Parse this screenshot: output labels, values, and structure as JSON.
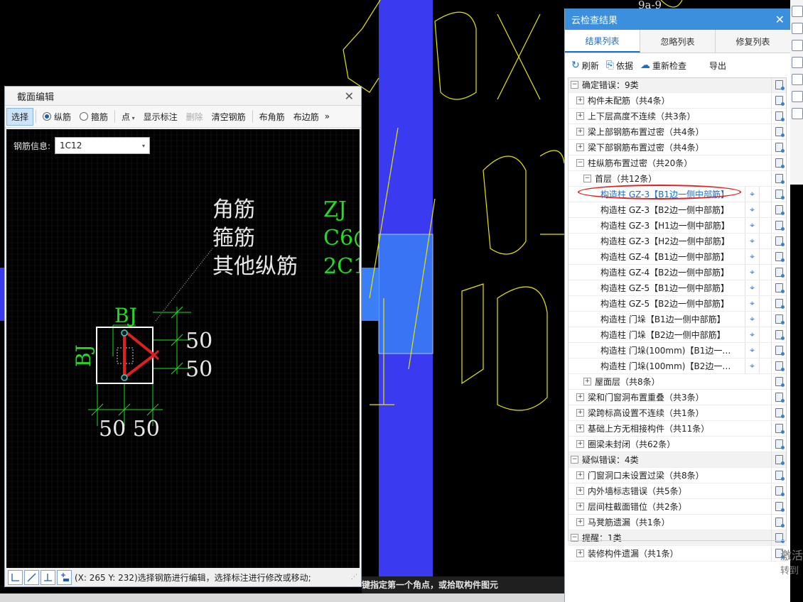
{
  "cad": {
    "label_9a9": "9a-9",
    "section": {
      "legend_labels": [
        "角筋",
        "箍筋",
        "其他纵筋"
      ],
      "legend_values": [
        "ZJ",
        "C6@",
        "2C1"
      ],
      "label_bj_top": "BJ",
      "label_bj_left": "BJ",
      "dim_right_1": "50",
      "dim_right_2": "50",
      "dim_bottom": "50 50"
    },
    "command_text": "键指定第一个角点，或拾取构件图元"
  },
  "section_editor": {
    "title": "截面编辑",
    "toolbar": {
      "select": "选择",
      "longitudinal": "纵筋",
      "stirrup": "箍筋",
      "point": "点",
      "show_dims": "显示标注",
      "delete": "删除",
      "clear_rebar": "清空钢筋",
      "corner_rebar": "布角筋",
      "edge_rebar": "布边筋",
      "more": "»"
    },
    "rebar_label": "钢筋信息:",
    "rebar_value": "1C12",
    "status_text": "(X: 265 Y: 232)选择钢筋进行编辑，选择标注进行修改或移动;"
  },
  "cloud": {
    "title": "云检查结果",
    "tabs": [
      "结果列表",
      "忽略列表",
      "修复列表"
    ],
    "actions": {
      "refresh": "刷新",
      "basis": "依据",
      "recheck": "重新检查",
      "export": "导出"
    },
    "rows": [
      {
        "label": "确定错误：9类",
        "level": 0,
        "exp": "−",
        "grp": true
      },
      {
        "label": "构件未配筋（共4条）",
        "level": 1,
        "exp": "+"
      },
      {
        "label": "上下层高度不连续（共3条）",
        "level": 1,
        "exp": "+"
      },
      {
        "label": "梁上部钢筋布置过密（共4条）",
        "level": 1,
        "exp": "+"
      },
      {
        "label": "梁下部钢筋布置过密（共4条）",
        "level": 1,
        "exp": "+"
      },
      {
        "label": "柱纵筋布置过密（共20条）",
        "level": 1,
        "exp": "−"
      },
      {
        "label": "首层（共12条）",
        "level": 2,
        "exp": "−"
      },
      {
        "label": "构造柱 GZ-3【B1边一侧中部筋】",
        "level": 3,
        "loc": true,
        "sel": true
      },
      {
        "label": "构造柱 GZ-3【B2边一侧中部筋】",
        "level": 3,
        "loc": true
      },
      {
        "label": "构造柱 GZ-3【H1边一侧中部筋】",
        "level": 3,
        "loc": true
      },
      {
        "label": "构造柱 GZ-3【H2边一侧中部筋】",
        "level": 3,
        "loc": true
      },
      {
        "label": "构造柱 GZ-4【B1边一侧中部筋】",
        "level": 3,
        "loc": true
      },
      {
        "label": "构造柱 GZ-4【B2边一侧中部筋】",
        "level": 3,
        "loc": true
      },
      {
        "label": "构造柱 GZ-5【B1边一侧中部筋】",
        "level": 3,
        "loc": true
      },
      {
        "label": "构造柱 GZ-5【B2边一侧中部筋】",
        "level": 3,
        "loc": true
      },
      {
        "label": "构造柱 门垛【B1边一侧中部筋】",
        "level": 3,
        "loc": true
      },
      {
        "label": "构造柱 门垛【B2边一侧中部筋】",
        "level": 3,
        "loc": true
      },
      {
        "label": "构造柱 门垛(100mm)【B1边一侧...",
        "level": 3,
        "loc": true
      },
      {
        "label": "构造柱 门垛(100mm)【B2边一侧...",
        "level": 3,
        "loc": true
      },
      {
        "label": "屋面层（共8条）",
        "level": 2,
        "exp": "+"
      },
      {
        "label": "梁和门窗洞布置重叠（共3条）",
        "level": 1,
        "exp": "+"
      },
      {
        "label": "梁跨标高设置不连续（共1条）",
        "level": 1,
        "exp": "+"
      },
      {
        "label": "基础上方无相接构件（共11条）",
        "level": 1,
        "exp": "+"
      },
      {
        "label": "圈梁未封闭（共62条）",
        "level": 1,
        "exp": "+"
      },
      {
        "label": "疑似错误：4类",
        "level": 0,
        "exp": "−",
        "grp": true
      },
      {
        "label": "门窗洞口未设置过梁（共8条）",
        "level": 1,
        "exp": "+"
      },
      {
        "label": "内外墙标志错误（共5条）",
        "level": 1,
        "exp": "+"
      },
      {
        "label": "层间柱截面错位（共2条）",
        "level": 1,
        "exp": "+"
      },
      {
        "label": "马凳筋遗漏（共1条）",
        "level": 1,
        "exp": "+"
      },
      {
        "label": "提醒：1类",
        "level": 0,
        "exp": "−",
        "grp": true
      },
      {
        "label": "装修构件遗漏（共1条）",
        "level": 1,
        "exp": "+"
      }
    ]
  },
  "watermark": {
    "line1": "激活",
    "line2": "转到"
  },
  "colors": {
    "accent": "#3c8fdc",
    "cad_yellow": "#e6e600",
    "cad_blue": "#3a3af0",
    "rebar_red": "#e02020",
    "dim_green": "#22dd22"
  }
}
